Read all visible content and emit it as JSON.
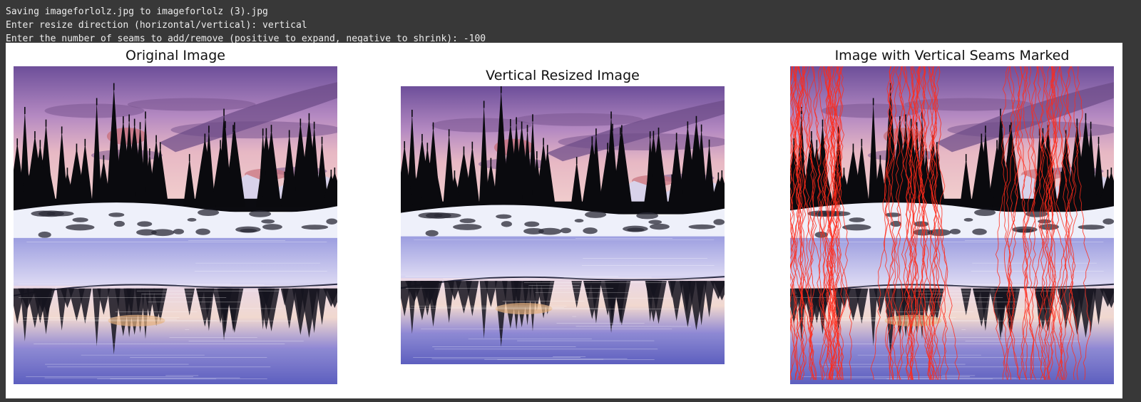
{
  "console": {
    "lines": [
      "Saving imageforlolz.jpg to imageforlolz (3).jpg",
      "Enter resize direction (horizontal/vertical): vertical",
      "Enter the number of seams to add/remove (positive to expand, negative to shrink): -100"
    ]
  },
  "figure": {
    "panels": [
      {
        "title": "Original Image"
      },
      {
        "title": "Vertical Resized Image"
      },
      {
        "title": "Image with Vertical Seams Marked"
      }
    ]
  },
  "colors": {
    "console_bg": "#383838",
    "console_text": "#ececec",
    "figure_bg": "#ffffff",
    "seam_color": "#ff2a1a"
  }
}
